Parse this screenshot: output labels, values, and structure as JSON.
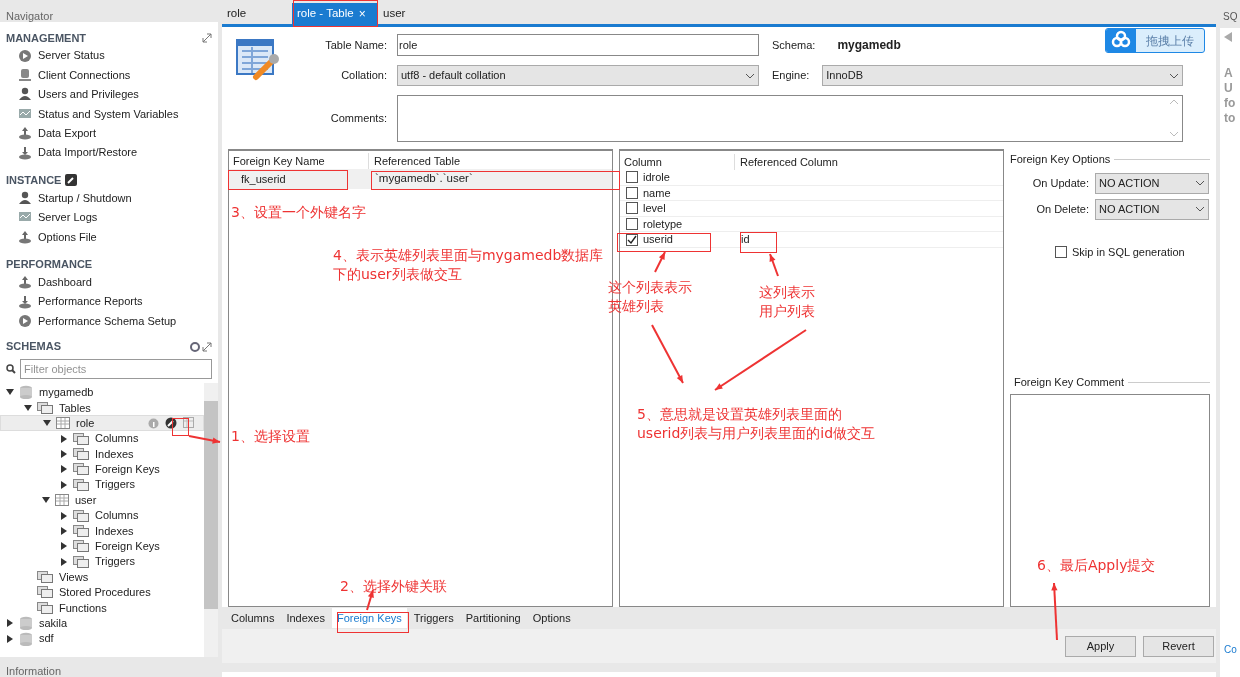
{
  "navigator": {
    "title": "Navigator",
    "sections": [
      {
        "title": "MANAGEMENT",
        "items": [
          "Server Status",
          "Client Connections",
          "Users and Privileges",
          "Status and System Variables",
          "Data Export",
          "Data Import/Restore"
        ]
      },
      {
        "title": "INSTANCE",
        "items": [
          "Startup / Shutdown",
          "Server Logs",
          "Options File"
        ]
      },
      {
        "title": "PERFORMANCE",
        "items": [
          "Dashboard",
          "Performance Reports",
          "Performance Schema Setup"
        ]
      }
    ],
    "schemas": {
      "title": "SCHEMAS",
      "filter_placeholder": "Filter objects",
      "tree": [
        {
          "label": "mygamedb",
          "expanded": true,
          "selected": false,
          "children": [
            {
              "label": "Tables",
              "expanded": true,
              "selected": false,
              "children": [
                {
                  "label": "role",
                  "expanded": true,
                  "selected": true,
                  "children": [
                    {
                      "label": "Columns",
                      "expanded": false,
                      "selected": false
                    },
                    {
                      "label": "Indexes",
                      "expanded": false,
                      "selected": false
                    },
                    {
                      "label": "Foreign Keys",
                      "expanded": false,
                      "selected": false
                    },
                    {
                      "label": "Triggers",
                      "expanded": false,
                      "selected": false
                    }
                  ]
                },
                {
                  "label": "user",
                  "expanded": true,
                  "selected": false,
                  "children": [
                    {
                      "label": "Columns",
                      "expanded": false,
                      "selected": false
                    },
                    {
                      "label": "Indexes",
                      "expanded": false,
                      "selected": false
                    },
                    {
                      "label": "Foreign Keys",
                      "expanded": false,
                      "selected": false
                    },
                    {
                      "label": "Triggers",
                      "expanded": false,
                      "selected": false
                    }
                  ]
                }
              ]
            },
            {
              "label": "Views",
              "selected": false
            },
            {
              "label": "Stored Procedures",
              "selected": false
            },
            {
              "label": "Functions",
              "selected": false
            }
          ]
        },
        {
          "label": "sakila",
          "expanded": false,
          "selected": false
        },
        {
          "label": "sdf",
          "expanded": false,
          "selected": false
        }
      ]
    },
    "footer": "Information"
  },
  "tabs": [
    {
      "label": "role",
      "selected": false
    },
    {
      "label": "role - Table",
      "selected": true,
      "close": "×"
    },
    {
      "label": "user",
      "selected": false
    }
  ],
  "form": {
    "table_name_label": "Table Name:",
    "table_name": "role",
    "schema_label": "Schema:",
    "schema": "mygamedb",
    "collation_label": "Collation:",
    "collation": "utf8 - default collation",
    "engine_label": "Engine:",
    "engine": "InnoDB",
    "comments_label": "Comments:"
  },
  "upload_button": "拖拽上传",
  "foreign_keys": {
    "columns": [
      "Foreign Key Name",
      "Referenced Table"
    ],
    "rows": [
      {
        "name": "fk_userid",
        "table": "`mygamedb`.`user`",
        "selected": true
      }
    ]
  },
  "fk_columns": {
    "columns": [
      "Column",
      "Referenced Column"
    ],
    "rows": [
      {
        "column": "idrole",
        "checked": false
      },
      {
        "column": "name",
        "checked": false
      },
      {
        "column": "level",
        "checked": false
      },
      {
        "column": "roletype",
        "checked": false
      },
      {
        "column": "userid",
        "checked": true,
        "referenced": "id"
      }
    ]
  },
  "fk_options": {
    "title": "Foreign Key Options",
    "on_update_label": "On Update:",
    "on_update": "NO ACTION",
    "on_delete_label": "On Delete:",
    "on_delete": "NO ACTION",
    "skip_label": "Skip in SQL generation",
    "skip_checked": false,
    "comment_title": "Foreign Key Comment"
  },
  "bottom_tabs": [
    {
      "label": "Columns",
      "selected": false
    },
    {
      "label": "Indexes",
      "selected": false
    },
    {
      "label": "Foreign Keys",
      "selected": true
    },
    {
      "label": "Triggers",
      "selected": false
    },
    {
      "label": "Partitioning",
      "selected": false
    },
    {
      "label": "Options",
      "selected": false
    }
  ],
  "buttons": [
    "Apply",
    "Revert"
  ],
  "side_panel": {
    "title": "SQ",
    "lines": [
      "A",
      "U",
      "fo",
      "to"
    ],
    "link": "Co"
  },
  "annotations": [
    {
      "lines": [
        "1、选择设置"
      ]
    },
    {
      "lines": [
        "2、选择外键关联"
      ]
    },
    {
      "lines": [
        "3、设置一个外键名字"
      ]
    },
    {
      "lines": [
        "4、表示英雄列表里面与mygamedb数据库",
        "下的user列表做交互"
      ]
    },
    {
      "lines": [
        "这个列表表示",
        "英雄列表"
      ]
    },
    {
      "lines": [
        "这列表示",
        "用户列表"
      ]
    },
    {
      "lines": [
        "5、意思就是设置英雄列表里面的",
        "userid列表与用户列表里面的id做交互"
      ]
    },
    {
      "lines": [
        "6、最后Apply提交"
      ]
    }
  ]
}
